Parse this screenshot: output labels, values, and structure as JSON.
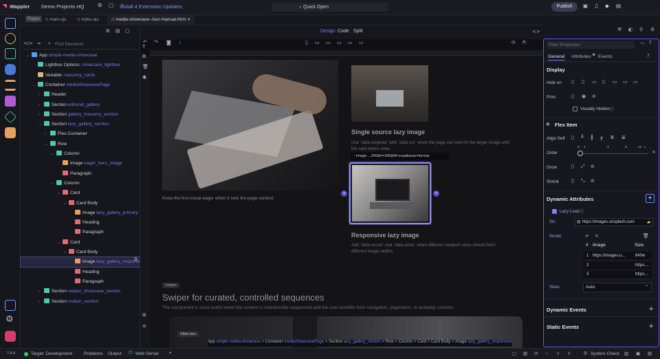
{
  "app": {
    "logo": "Wappler",
    "project": "Demo Projects HQ",
    "update_notice": "Install 4 Extension Updates",
    "quick_open": "Quick Open",
    "publish": "Publish"
  },
  "tabs": [
    {
      "label": "Pages"
    },
    {
      "label": "main.ejs"
    },
    {
      "label": "index.ejs"
    },
    {
      "label": "media-showcase--tour-manual.html"
    }
  ],
  "view_modes": {
    "design": "Design",
    "code": "Code",
    "split": "Split"
  },
  "tree": {
    "search_placeholder": "Find Elements",
    "rows": [
      {
        "indent": 0,
        "chev": "⌄",
        "color": "#5a9cf6",
        "label": "App",
        "sub": "simple-media-showcase"
      },
      {
        "indent": 1,
        "chev": "",
        "color": "#4ec9b0",
        "label": "Lightbox Options:",
        "sub": "showcase_lightbox"
      },
      {
        "indent": 1,
        "chev": "",
        "color": "#d7ba7d",
        "label": "Variable:",
        "sub": "masonry_cards"
      },
      {
        "indent": 1,
        "chev": "⌄",
        "color": "#4ec9b0",
        "label": "Container",
        "sub": "mediaShowcasePage"
      },
      {
        "indent": 2,
        "chev": "›",
        "color": "#4ec9b0",
        "label": "Header",
        "sub": ""
      },
      {
        "indent": 2,
        "chev": "›",
        "color": "#4ec9b0",
        "label": "Section",
        "sub": "editorial_gallery"
      },
      {
        "indent": 2,
        "chev": "›",
        "color": "#4ec9b0",
        "label": "Section",
        "sub": "gallery_masonry_section"
      },
      {
        "indent": 2,
        "chev": "⌄",
        "color": "#4ec9b0",
        "label": "Section",
        "sub": "lazy_gallery_section"
      },
      {
        "indent": 3,
        "chev": "›",
        "color": "#4ec9b0",
        "label": "Flex Container",
        "sub": ""
      },
      {
        "indent": 3,
        "chev": "⌄",
        "color": "#4ec9b0",
        "label": "Row",
        "sub": ""
      },
      {
        "indent": 4,
        "chev": "⌄",
        "color": "#4ec9b0",
        "label": "Column",
        "sub": ""
      },
      {
        "indent": 5,
        "chev": "",
        "color": "#e8a15c",
        "label": "Image",
        "sub": "eager_hero_image"
      },
      {
        "indent": 5,
        "chev": "",
        "color": "#e06c75",
        "label": "Paragraph",
        "sub": ""
      },
      {
        "indent": 4,
        "chev": "⌄",
        "color": "#4ec9b0",
        "label": "Column",
        "sub": ""
      },
      {
        "indent": 5,
        "chev": "⌄",
        "color": "#e06c75",
        "label": "Card",
        "sub": ""
      },
      {
        "indent": 6,
        "chev": "⌄",
        "color": "#e06c75",
        "label": "Card Body",
        "sub": ""
      },
      {
        "indent": 7,
        "chev": "",
        "color": "#e8a15c",
        "label": "Image",
        "sub": "lazy_gallery_primary"
      },
      {
        "indent": 7,
        "chev": "",
        "color": "#e06c75",
        "label": "Heading",
        "sub": ""
      },
      {
        "indent": 7,
        "chev": "",
        "color": "#e06c75",
        "label": "Paragraph",
        "sub": ""
      },
      {
        "indent": 5,
        "chev": "⌄",
        "color": "#e06c75",
        "label": "Card",
        "sub": ""
      },
      {
        "indent": 6,
        "chev": "⌄",
        "color": "#e06c75",
        "label": "Card Body",
        "sub": ""
      },
      {
        "indent": 7,
        "chev": "",
        "color": "#e8a15c",
        "label": "Image",
        "sub": "lazy_gallery_responsive",
        "selected": true
      },
      {
        "indent": 7,
        "chev": "",
        "color": "#e06c75",
        "label": "Heading",
        "sub": ""
      },
      {
        "indent": 7,
        "chev": "",
        "color": "#e06c75",
        "label": "Paragraph",
        "sub": ""
      },
      {
        "indent": 2,
        "chev": "›",
        "color": "#4ec9b0",
        "label": "Section",
        "sub": "swiper_showcase_section"
      },
      {
        "indent": 2,
        "chev": "›",
        "color": "#4ec9b0",
        "label": "Section",
        "sub": "motion_section"
      }
    ]
  },
  "canvas": {
    "hero_caption": "Keep the first visual eager when it sets the page context.",
    "card1_title": "Single source lazy image",
    "card1_text": "Use `data-lazyload` with `data-src` when the page can wait for the larger image until the card enters view.",
    "tooltip": "Image ...240&h=180&fit=crop&auto=format",
    "card2_title": "Responsive lazy image",
    "card2_text": "Add `data-srcset` and `data-sizes` when different viewport sizes should fetch different image widths.",
    "badge": "Swiper",
    "section_title": "Swiper for curated, controlled sequences",
    "section_text": "The component is most useful when the content is intentionally sequenced and the user benefits from navigation, pagination, or autoplay controls.",
    "slide_label": "Slide two"
  },
  "breadcrumb": [
    {
      "t": "App",
      "s": "simple-media-showcase"
    },
    {
      "t": "Container",
      "s": "mediaShowcasePage"
    },
    {
      "t": "Section",
      "s": "lazy_gallery_section"
    },
    {
      "t": "Row",
      "s": ""
    },
    {
      "t": "Column",
      "s": ""
    },
    {
      "t": "Card",
      "s": ""
    },
    {
      "t": "Card Body",
      "s": ""
    },
    {
      "t": "Image",
      "s": "lazy_gallery_responsive"
    }
  ],
  "props": {
    "filter_placeholder": "Filter Properties",
    "tabs": [
      "General",
      "Attributes",
      "Events"
    ],
    "display_title": "Display",
    "hide_on": "Hide on",
    "print": "Print",
    "visually_hidden": "Visually Hidden",
    "flex_item_title": "Flex Item",
    "align_self": "Align Self",
    "order": "Order",
    "order_ticks": [
      "0",
      "1",
      "3",
      "9",
      "12",
      "L"
    ],
    "grow": "Grow",
    "shrink": "Shrink",
    "dynamic_attributes": "Dynamic Attributes",
    "lazy_load": "Lazy Load",
    "src_label": "Src",
    "src_value": "https://images.unsplash.com",
    "srcset_label": "Srcset",
    "col_hash": "#",
    "col_image": "Image",
    "col_size": "Size",
    "srcset_rows": [
      {
        "n": "1",
        "image": "https://images.u...",
        "size": "640w"
      },
      {
        "n": "2",
        "image": "",
        "size": "https:..."
      },
      {
        "n": "3",
        "image": "",
        "size": "https:..."
      }
    ],
    "sizes_label": "Sizes",
    "sizes_value": "Auto",
    "dynamic_events": "Dynamic Events",
    "static_events": "Static Events"
  },
  "status": {
    "version": "7.5.4",
    "target": "Target: Development",
    "problems": "Problems",
    "output": "Output",
    "web_server": "Web Server",
    "system_check": "System Check"
  },
  "colors": {
    "accent": "#6a55ff",
    "link": "#7a7af0",
    "selected": "#262640"
  }
}
